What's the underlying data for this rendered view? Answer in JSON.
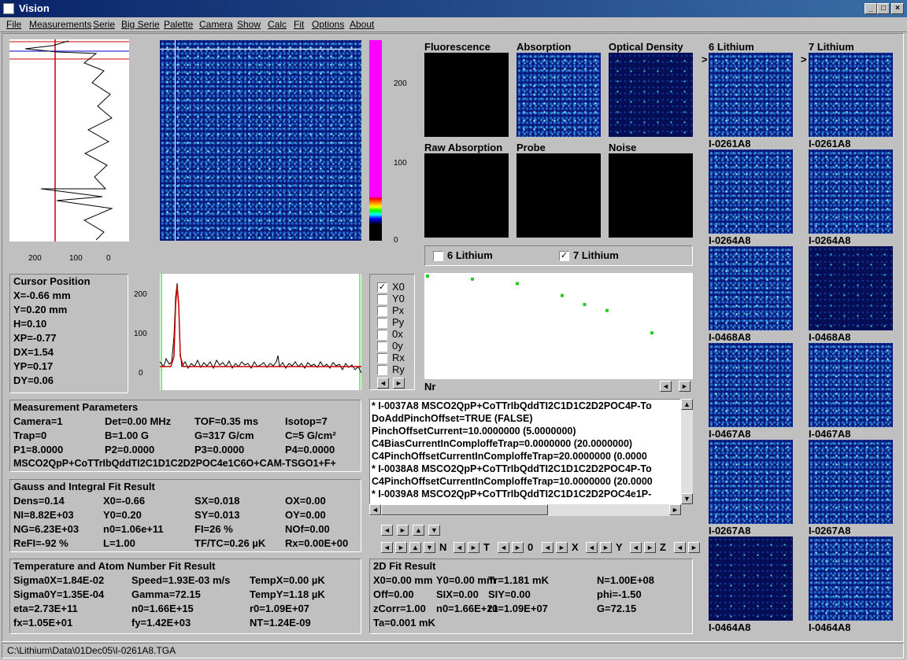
{
  "window": {
    "title": "Vision"
  },
  "menu": [
    "File",
    "Measurements",
    "Serie",
    "Big Serie",
    "Palette",
    "Camera",
    "Show",
    "Calc",
    "Fit",
    "Options",
    "About"
  ],
  "colorbar_ticks": [
    "200",
    "100",
    "0"
  ],
  "profile_v_ticks": [
    "200",
    "100",
    "0"
  ],
  "profile_h_ticks": [
    "200",
    "100",
    "0"
  ],
  "image_panels": {
    "fluorescence": "Fluorescence",
    "absorption": "Absorption",
    "optical_density": "Optical Density",
    "raw_absorption": "Raw Absorption",
    "probe": "Probe",
    "noise": "Noise"
  },
  "species": {
    "li6": "6 Lithium",
    "li7": "7 Lithium",
    "li6_checked": false,
    "li7_checked": true
  },
  "thumb_headers": {
    "left": "6 Lithium",
    "right": "7 Lithium",
    "marker": ">"
  },
  "thumbs_left": [
    "I-0261A8",
    "I-0264A8",
    "I-0468A8",
    "I-0467A8",
    "I-0267A8",
    "I-0464A8"
  ],
  "thumbs_right": [
    "I-0261A8",
    "I-0264A8",
    "I-0468A8",
    "I-0467A8",
    "I-0267A8",
    "I-0464A8"
  ],
  "cursor": {
    "title": "Cursor Position",
    "lines": [
      "X=-0.66 mm",
      "Y=0.20 mm",
      "H=0.10",
      "XP=-0.77",
      "DX=1.54",
      "YP=0.17",
      "DY=0.06"
    ]
  },
  "fit_checks": [
    {
      "label": "X0",
      "checked": true
    },
    {
      "label": "Y0",
      "checked": false
    },
    {
      "label": "Px",
      "checked": false
    },
    {
      "label": "Py",
      "checked": false
    },
    {
      "label": "0x",
      "checked": false
    },
    {
      "label": "0y",
      "checked": false
    },
    {
      "label": "Rx",
      "checked": false
    },
    {
      "label": "Ry",
      "checked": false
    }
  ],
  "plot_axis": "Nr",
  "measurement": {
    "title": "Measurement Parameters",
    "rows": [
      [
        "Camera=1",
        "Det=0.00 MHz",
        "TOF=0.35 ms",
        "Isotop=7"
      ],
      [
        "Trap=0",
        "B=1.00 G",
        "G=317 G/cm",
        "C=5 G/cm²"
      ],
      [
        "P1=8.0000",
        "P2=0.0000",
        "P3=0.0000",
        "P4=0.0000"
      ]
    ],
    "sequence": "MSCO2QpP+CoTTrIbQddTI2C1D1C2D2POC4e1C6O+CAM-TSGO1+F+"
  },
  "gauss": {
    "title": "Gauss and Integral Fit Result",
    "rows": [
      [
        "Dens=0.14",
        "X0=-0.66",
        "SX=0.018",
        "OX=0.00"
      ],
      [
        "NI=8.82E+03",
        "Y0=0.20",
        "SY=0.013",
        "OY=0.00"
      ],
      [
        "NG=6.23E+03",
        "n0=1.06e+11",
        "FI=26 %",
        "NOf=0.00"
      ],
      [
        "ReFI=-92 %",
        "L=1.00",
        "TF/TC=0.26  µK",
        "Rx=0.00E+00"
      ]
    ]
  },
  "temp": {
    "title": "Temperature and Atom Number Fit Result",
    "rows": [
      [
        "Sigma0X=1.84E-02",
        "Speed=1.93E-03 m/s",
        "TempX=0.00 µK"
      ],
      [
        "Sigma0Y=1.35E-04",
        "Gamma=72.15",
        "TempY=1.18 µK"
      ],
      [
        "eta=2.73E+11",
        "n0=1.66E+15",
        "r0=1.09E+07"
      ],
      [
        "fx=1.05E+01",
        "fy=1.42E+03",
        "NT=1.24E-09"
      ]
    ]
  },
  "log": [
    "* I-0037A8   MSCO2QpP+CoTTrIbQddTI2C1D1C2D2POC4P-To",
    "  DoAddPinchOffset=TRUE (FALSE)",
    "  PinchOffsetCurrent=10.0000000 (5.0000000)",
    "  C4BiasCurrentInComploffeTrap=0.0000000 (20.0000000)",
    "  C4PinchOffsetCurrentInComploffeTrap=20.0000000 (0.0000",
    "* I-0038A8   MSCO2QpP+CoTTrIbQddTI2C1D1C2D2POC4P-To",
    "  C4PinchOffsetCurrentInComploffeTrap=10.0000000 (20.0000",
    "* I-0039A8   MSCO2QpP+CoTTrIbQddTI2C1D1C2D2POC4e1P-"
  ],
  "nav_letters": [
    "N",
    "T",
    "0",
    "X",
    "Y",
    "Z"
  ],
  "fit2d": {
    "title": "2D Fit Result",
    "rows": [
      [
        "X0=0.00 mm",
        "Y0=0.00 mm",
        "Tr=1.181 mK",
        "N=1.00E+08"
      ],
      [
        "Off=0.00",
        "SIX=0.00",
        "SIY=0.00",
        "phi=-1.50"
      ],
      [
        "zCorr=1.00",
        "n0=1.66E+21",
        "r0=1.09E+07",
        "G=72.15"
      ],
      [
        "Ta=0.001 mK",
        "",
        "",
        ""
      ]
    ]
  },
  "scatter": {
    "x": [
      0,
      1,
      2,
      3,
      3.5,
      4,
      5
    ],
    "y": [
      1.0,
      0.98,
      0.95,
      0.87,
      0.81,
      0.77,
      0.62
    ]
  },
  "status": "C:\\Lithium\\Data\\01Dec05\\I-0261A8.TGA"
}
